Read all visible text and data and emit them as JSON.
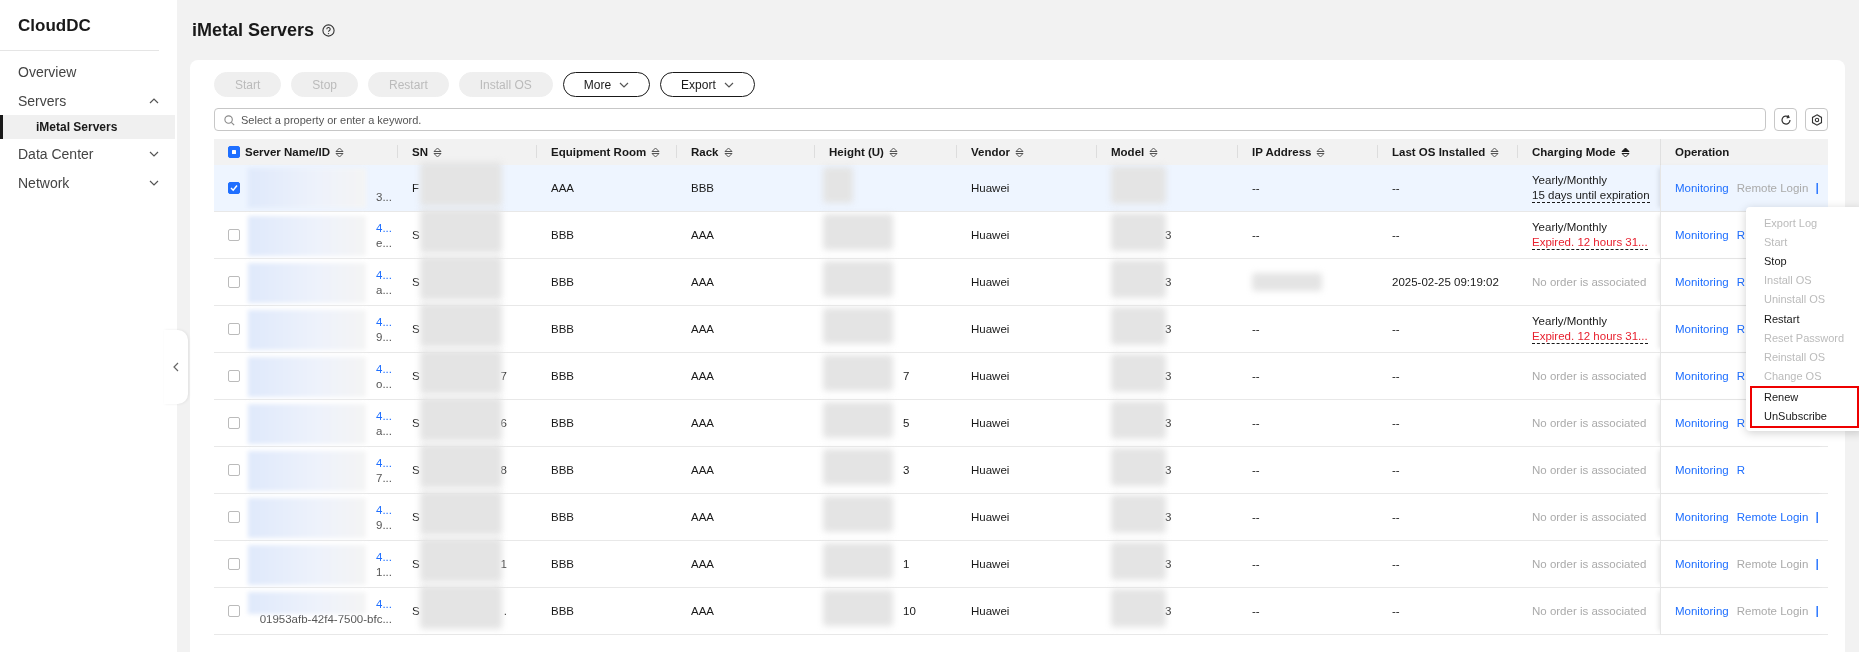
{
  "sidebar": {
    "title": "CloudDC",
    "items": [
      {
        "label": "Overview",
        "selected": false
      },
      {
        "label": "Servers",
        "expanded": true,
        "selected": false,
        "children": [
          {
            "label": "iMetal Servers",
            "selected": true
          }
        ]
      },
      {
        "label": "Data Center",
        "expanded": false,
        "selected": false
      },
      {
        "label": "Network",
        "expanded": false,
        "selected": false
      }
    ]
  },
  "page": {
    "title": "iMetal Servers"
  },
  "toolbar": {
    "buttons": [
      {
        "label": "Start",
        "kind": "action",
        "disabled": true
      },
      {
        "label": "Stop",
        "kind": "action",
        "disabled": true
      },
      {
        "label": "Restart",
        "kind": "action",
        "disabled": true
      },
      {
        "label": "Install OS",
        "kind": "action",
        "disabled": true
      },
      {
        "label": "More",
        "kind": "dropdown",
        "disabled": false
      },
      {
        "label": "Export",
        "kind": "dropdown",
        "disabled": false
      }
    ]
  },
  "search": {
    "placeholder": "Select a property or enter a keyword."
  },
  "table": {
    "columns": [
      {
        "label": "Server Name/ID",
        "kind": "sortable",
        "sorted": false
      },
      {
        "label": "SN",
        "kind": "sortable",
        "sorted": false
      },
      {
        "label": "Equipment Room",
        "kind": "sortable",
        "sorted": false
      },
      {
        "label": "Rack",
        "kind": "sortable",
        "sorted": false
      },
      {
        "label": "Height (U)",
        "kind": "sortable",
        "sorted": false
      },
      {
        "label": "Vendor",
        "kind": "sortable",
        "sorted": false
      },
      {
        "label": "Model",
        "kind": "sortable",
        "sorted": false
      },
      {
        "label": "IP Address",
        "kind": "sortable",
        "sorted": false
      },
      {
        "label": "Last OS Installed",
        "kind": "sortable",
        "sorted": false
      },
      {
        "label": "Charging Mode",
        "kind": "sortable",
        "sorted": true
      },
      {
        "label": "Operation",
        "kind": "plain"
      }
    ],
    "select_all_indeterminate": true,
    "rows": [
      {
        "selected": true,
        "name": "",
        "id": "3...",
        "id_redacted": true,
        "sn_start": "F",
        "sn_end": "",
        "room": "AAA",
        "rack": "BBB",
        "height_end": "",
        "vendor": "Huawei",
        "model_end": "",
        "ip": "--",
        "ip_redacted": false,
        "last_os": "--",
        "charging": {
          "kind": "subscription",
          "mode": "Yearly/Monthly",
          "status": "15 days until expiration",
          "expired": false
        },
        "monitoring": "Monitoring",
        "remote_login": "Remote Login",
        "remote_login_disabled": true,
        "more": true
      },
      {
        "selected": false,
        "name": "4...",
        "id": "e...",
        "id_redacted": true,
        "sn_start": "S",
        "sn_end": "",
        "room": "BBB",
        "rack": "AAA",
        "height_end": "",
        "vendor": "Huawei",
        "model_end": "3",
        "ip": "--",
        "ip_redacted": false,
        "last_os": "--",
        "charging": {
          "kind": "subscription",
          "mode": "Yearly/Monthly",
          "status": "Expired. 12 hours 31...",
          "expired": true
        },
        "monitoring": "Monitoring",
        "remote_login": "R",
        "remote_login_disabled": false,
        "more": false
      },
      {
        "selected": false,
        "name": "4...",
        "id": "a...",
        "id_redacted": true,
        "sn_start": "S",
        "sn_end": "",
        "room": "BBB",
        "rack": "AAA",
        "height_end": "",
        "vendor": "Huawei",
        "model_end": "3",
        "ip": "",
        "ip_redacted": true,
        "last_os": "2025-02-25 09:19:02",
        "charging": {
          "kind": "none",
          "text": "No order is associated"
        },
        "monitoring": "Monitoring",
        "remote_login": "R",
        "remote_login_disabled": false,
        "more": false
      },
      {
        "selected": false,
        "name": "4...",
        "id": "9...",
        "id_redacted": true,
        "sn_start": "S",
        "sn_end": "",
        "room": "BBB",
        "rack": "AAA",
        "height_end": "",
        "vendor": "Huawei",
        "model_end": "3",
        "ip": "--",
        "ip_redacted": false,
        "last_os": "--",
        "charging": {
          "kind": "subscription",
          "mode": "Yearly/Monthly",
          "status": "Expired. 12 hours 31...",
          "expired": true
        },
        "monitoring": "Monitoring",
        "remote_login": "R",
        "remote_login_disabled": false,
        "more": false
      },
      {
        "selected": false,
        "name": "4...",
        "id": "o...",
        "id_redacted": true,
        "sn_start": "S",
        "sn_end": "7",
        "room": "BBB",
        "rack": "AAA",
        "height_end": "7",
        "vendor": "Huawei",
        "model_end": "3",
        "ip": "--",
        "ip_redacted": false,
        "last_os": "--",
        "charging": {
          "kind": "none",
          "text": "No order is associated"
        },
        "monitoring": "Monitoring",
        "remote_login": "R",
        "remote_login_disabled": false,
        "more": false
      },
      {
        "selected": false,
        "name": "4...",
        "id": "a...",
        "id_redacted": true,
        "sn_start": "S",
        "sn_end": "6",
        "room": "BBB",
        "rack": "AAA",
        "height_end": "5",
        "vendor": "Huawei",
        "model_end": "3",
        "ip": "--",
        "ip_redacted": false,
        "last_os": "--",
        "charging": {
          "kind": "none",
          "text": "No order is associated"
        },
        "monitoring": "Monitoring",
        "remote_login": "R",
        "remote_login_disabled": false,
        "more": false
      },
      {
        "selected": false,
        "name": "4...",
        "id": "7...",
        "id_redacted": true,
        "sn_start": "S",
        "sn_end": "8",
        "room": "BBB",
        "rack": "AAA",
        "height_end": "3",
        "vendor": "Huawei",
        "model_end": "3",
        "ip": "--",
        "ip_redacted": false,
        "last_os": "--",
        "charging": {
          "kind": "none",
          "text": "No order is associated"
        },
        "monitoring": "Monitoring",
        "remote_login": "R",
        "remote_login_disabled": false,
        "more": false
      },
      {
        "selected": false,
        "name": "4...",
        "id": "9...",
        "id_redacted": true,
        "sn_start": "S",
        "sn_end": "",
        "room": "BBB",
        "rack": "AAA",
        "height_end": "",
        "vendor": "Huawei",
        "model_end": "3",
        "ip": "--",
        "ip_redacted": false,
        "last_os": "--",
        "charging": {
          "kind": "none",
          "text": "No order is associated"
        },
        "monitoring": "Monitoring",
        "remote_login": "Remote Login",
        "remote_login_disabled": false,
        "more": true
      },
      {
        "selected": false,
        "name": "4...",
        "id": "1...",
        "id_redacted": true,
        "sn_start": "S",
        "sn_end": "1",
        "room": "BBB",
        "rack": "AAA",
        "height_end": "1",
        "vendor": "Huawei",
        "model_end": "3",
        "ip": "--",
        "ip_redacted": false,
        "last_os": "--",
        "charging": {
          "kind": "none",
          "text": "No order is associated"
        },
        "monitoring": "Monitoring",
        "remote_login": "Remote Login",
        "remote_login_disabled": true,
        "more": true
      },
      {
        "selected": false,
        "name": "4...",
        "id": "01953afb-42f4-7500-bfc...",
        "id_redacted": false,
        "sn_start": "S",
        "sn_end": ".",
        "room": "BBB",
        "rack": "AAA",
        "height_end": "10",
        "vendor": "Huawei",
        "model_end": "3",
        "ip": "--",
        "ip_redacted": false,
        "last_os": "--",
        "charging": {
          "kind": "none",
          "text": "No order is associated"
        },
        "monitoring": "Monitoring",
        "remote_login": "Remote Login",
        "remote_login_disabled": true,
        "more": true
      }
    ]
  },
  "more_menu": {
    "items": [
      {
        "label": "Export Log",
        "disabled": true,
        "highlighted": false
      },
      {
        "label": "Start",
        "disabled": true,
        "highlighted": false
      },
      {
        "label": "Stop",
        "disabled": false,
        "highlighted": false
      },
      {
        "label": "Install OS",
        "disabled": true,
        "highlighted": false
      },
      {
        "label": "Uninstall OS",
        "disabled": true,
        "highlighted": false
      },
      {
        "label": "Restart",
        "disabled": false,
        "highlighted": false
      },
      {
        "label": "Reset Password",
        "disabled": true,
        "highlighted": false
      },
      {
        "label": "Reinstall OS",
        "disabled": true,
        "highlighted": false
      },
      {
        "label": "Change OS",
        "disabled": true,
        "highlighted": false
      },
      {
        "label": "Renew",
        "disabled": false,
        "highlighted": true
      },
      {
        "label": "UnSubscribe",
        "disabled": false,
        "highlighted": true
      }
    ]
  }
}
